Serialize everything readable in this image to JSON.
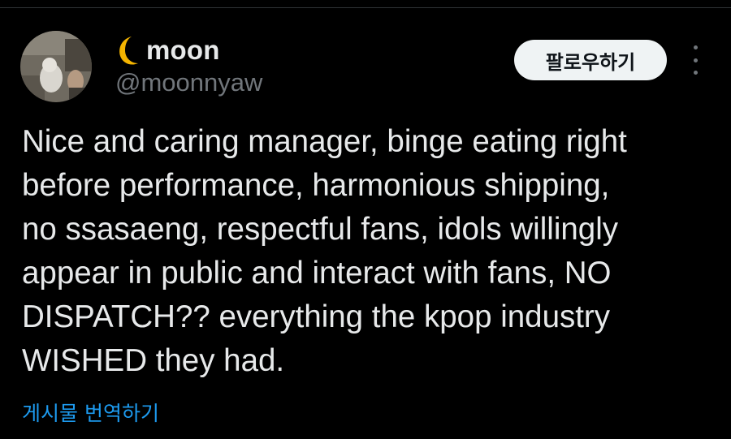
{
  "tweet": {
    "author": {
      "display_name": "moon",
      "name_emoji": "crescent-moon-icon",
      "handle": "@moonnyaw"
    },
    "follow_button_label": "팔로우하기",
    "more_options_icon": "more-vertical-icon",
    "text": "Nice and caring manager, binge eating right\nbefore performance, harmonious shipping,\nno ssasaeng, respectful fans, idols willingly\nappear in public and interact with fans, NO\nDISPATCH?? everything the kpop industry\nWISHED they had.",
    "translate_label": "게시물 번역하기"
  },
  "colors": {
    "background": "#000000",
    "text_primary": "#e7e9ea",
    "text_secondary": "#71767b",
    "link": "#1d9bf0",
    "button_bg": "#eff3f4",
    "button_text": "#0f1419",
    "moon": "#f4b400"
  }
}
